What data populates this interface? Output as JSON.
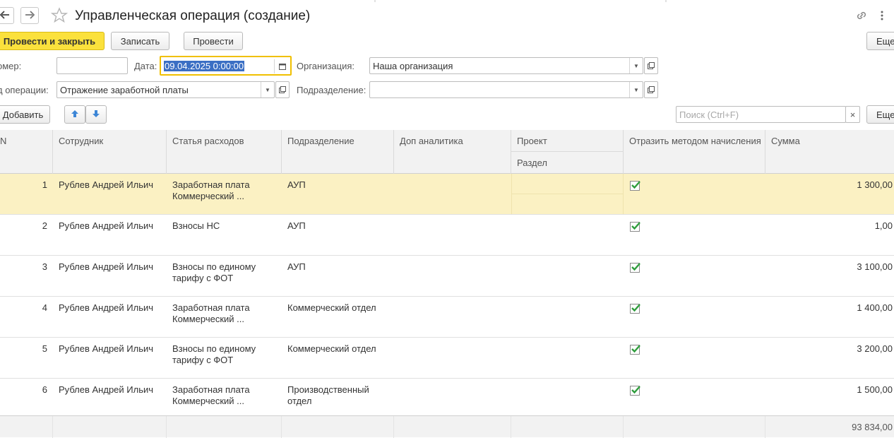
{
  "window": {
    "title": "Управленческая операция (создание)"
  },
  "toolbar": {
    "post_close": "Провести и закрыть",
    "save": "Записать",
    "post": "Провести",
    "more": "Еще"
  },
  "form": {
    "number_label": "омер:",
    "number_value": "",
    "date_label": "Дата:",
    "date_value": "09.04.2025  0:00:00",
    "org_label": "Организация:",
    "org_value": "Наша организация",
    "optype_label": "д операции:",
    "optype_value": "Отражение заработной платы",
    "dept_label": "Подразделение:",
    "dept_value": ""
  },
  "table_toolbar": {
    "add": "Добавить",
    "search_placeholder": "Поиск (Ctrl+F)",
    "more": "Еще"
  },
  "table": {
    "columns": {
      "n": "N",
      "employee": "Сотрудник",
      "expense": "Статья расходов",
      "department": "Подразделение",
      "extra": "Доп аналитика",
      "project": "Проект",
      "section": "Раздел",
      "accrual": "Отразить методом начисления",
      "sum": "Сумма"
    },
    "rows": [
      {
        "n": "1",
        "employee": "Рублев Андрей Ильич",
        "expense": "Заработная плата Коммерческий ...",
        "department": "АУП",
        "accrual": true,
        "sum": "1 300,00"
      },
      {
        "n": "2",
        "employee": "Рублев Андрей Ильич",
        "expense": "Взносы НС",
        "department": "АУП",
        "accrual": true,
        "sum": "1,00"
      },
      {
        "n": "3",
        "employee": "Рублев Андрей Ильич",
        "expense": "Взносы по единому тарифу с ФОТ",
        "department": "АУП",
        "accrual": true,
        "sum": "3 100,00"
      },
      {
        "n": "4",
        "employee": "Рублев Андрей Ильич",
        "expense": "Заработная плата Коммерческий ...",
        "department": "Коммерческий отдел",
        "accrual": true,
        "sum": "1 400,00"
      },
      {
        "n": "5",
        "employee": "Рублев Андрей Ильич",
        "expense": "Взносы по единому тарифу с ФОТ",
        "department": "Коммерческий отдел",
        "accrual": true,
        "sum": "3 200,00"
      },
      {
        "n": "6",
        "employee": "Рублев Андрей Ильич",
        "expense": "Заработная плата Коммерческий ...",
        "department": "Производственный отдел",
        "accrual": true,
        "sum": "1 500,00"
      }
    ],
    "total": "93 834,00"
  },
  "colors": {
    "primary_button": "#fbe13c",
    "selected_row": "#fbf1c3",
    "focus_border": "#f0c000",
    "check": "#2e9d3c",
    "arrow": "#3d86d6"
  }
}
